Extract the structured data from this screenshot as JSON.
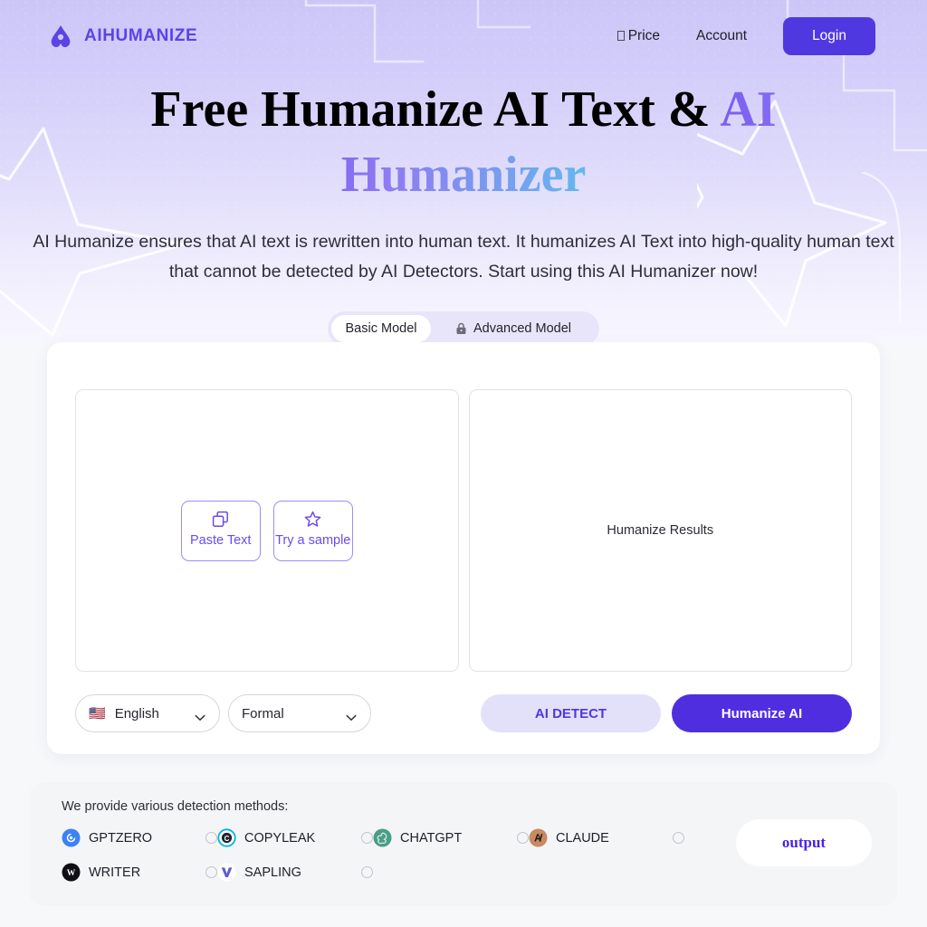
{
  "brand": {
    "name": "AIHUMANIZE",
    "logo_icon": "aihumanize-logo-icon",
    "accent": "#5b43e8"
  },
  "nav": {
    "price_label": "Price",
    "account_label": "Account",
    "login_label": "Login",
    "login_bg": "#4f38e0"
  },
  "hero": {
    "headline_part1": "Free Humanize AI Text & ",
    "headline_accent": "AI Humanizer",
    "headline_gradient_from": "#7a5cf0",
    "headline_gradient_to": "#63b8ee",
    "subheadline": "AI Humanize ensures that AI text is rewritten into human text. It humanizes AI Text into high-quality human text that cannot be detected by AI Detectors. Start using this AI Humanizer now!",
    "model_basic": "Basic Model",
    "model_advanced": "Advanced Model",
    "lock_icon": "lock-icon"
  },
  "editor": {
    "paste_icon": "copy-paste-icon",
    "paste_label": "Paste Text",
    "sample_icon": "star-icon",
    "sample_label": "Try a sample",
    "results_placeholder": "Humanize Results"
  },
  "controls": {
    "language_flag": "🇺🇸",
    "language_value": "English",
    "tone_value": "Formal",
    "chevron_icon": "chevron-down-icon",
    "detect_label": "AI DETECT",
    "humanize_label": "Humanize AI",
    "detect_bg": "#e3e0fa",
    "humanize_bg": "#4f2ee0"
  },
  "detectors": {
    "title": "We provide various detection methods:",
    "items": [
      {
        "label": "GPTZERO",
        "icon": "gptzero-icon",
        "color": "#3b82f6"
      },
      {
        "label": "COPYLEAK",
        "icon": "copyleaks-icon",
        "color": "#00b4e0"
      },
      {
        "label": "CHATGPT",
        "icon": "chatgpt-icon",
        "color": "#4a9e85"
      },
      {
        "label": "CLAUDE",
        "icon": "claude-icon",
        "color": "#c98a63"
      },
      {
        "label": "WRITER",
        "icon": "writer-icon",
        "color": "#101014"
      },
      {
        "label": "SAPLING",
        "icon": "sapling-icon",
        "color": "#5a5fd6"
      }
    ],
    "output_label": "output"
  }
}
